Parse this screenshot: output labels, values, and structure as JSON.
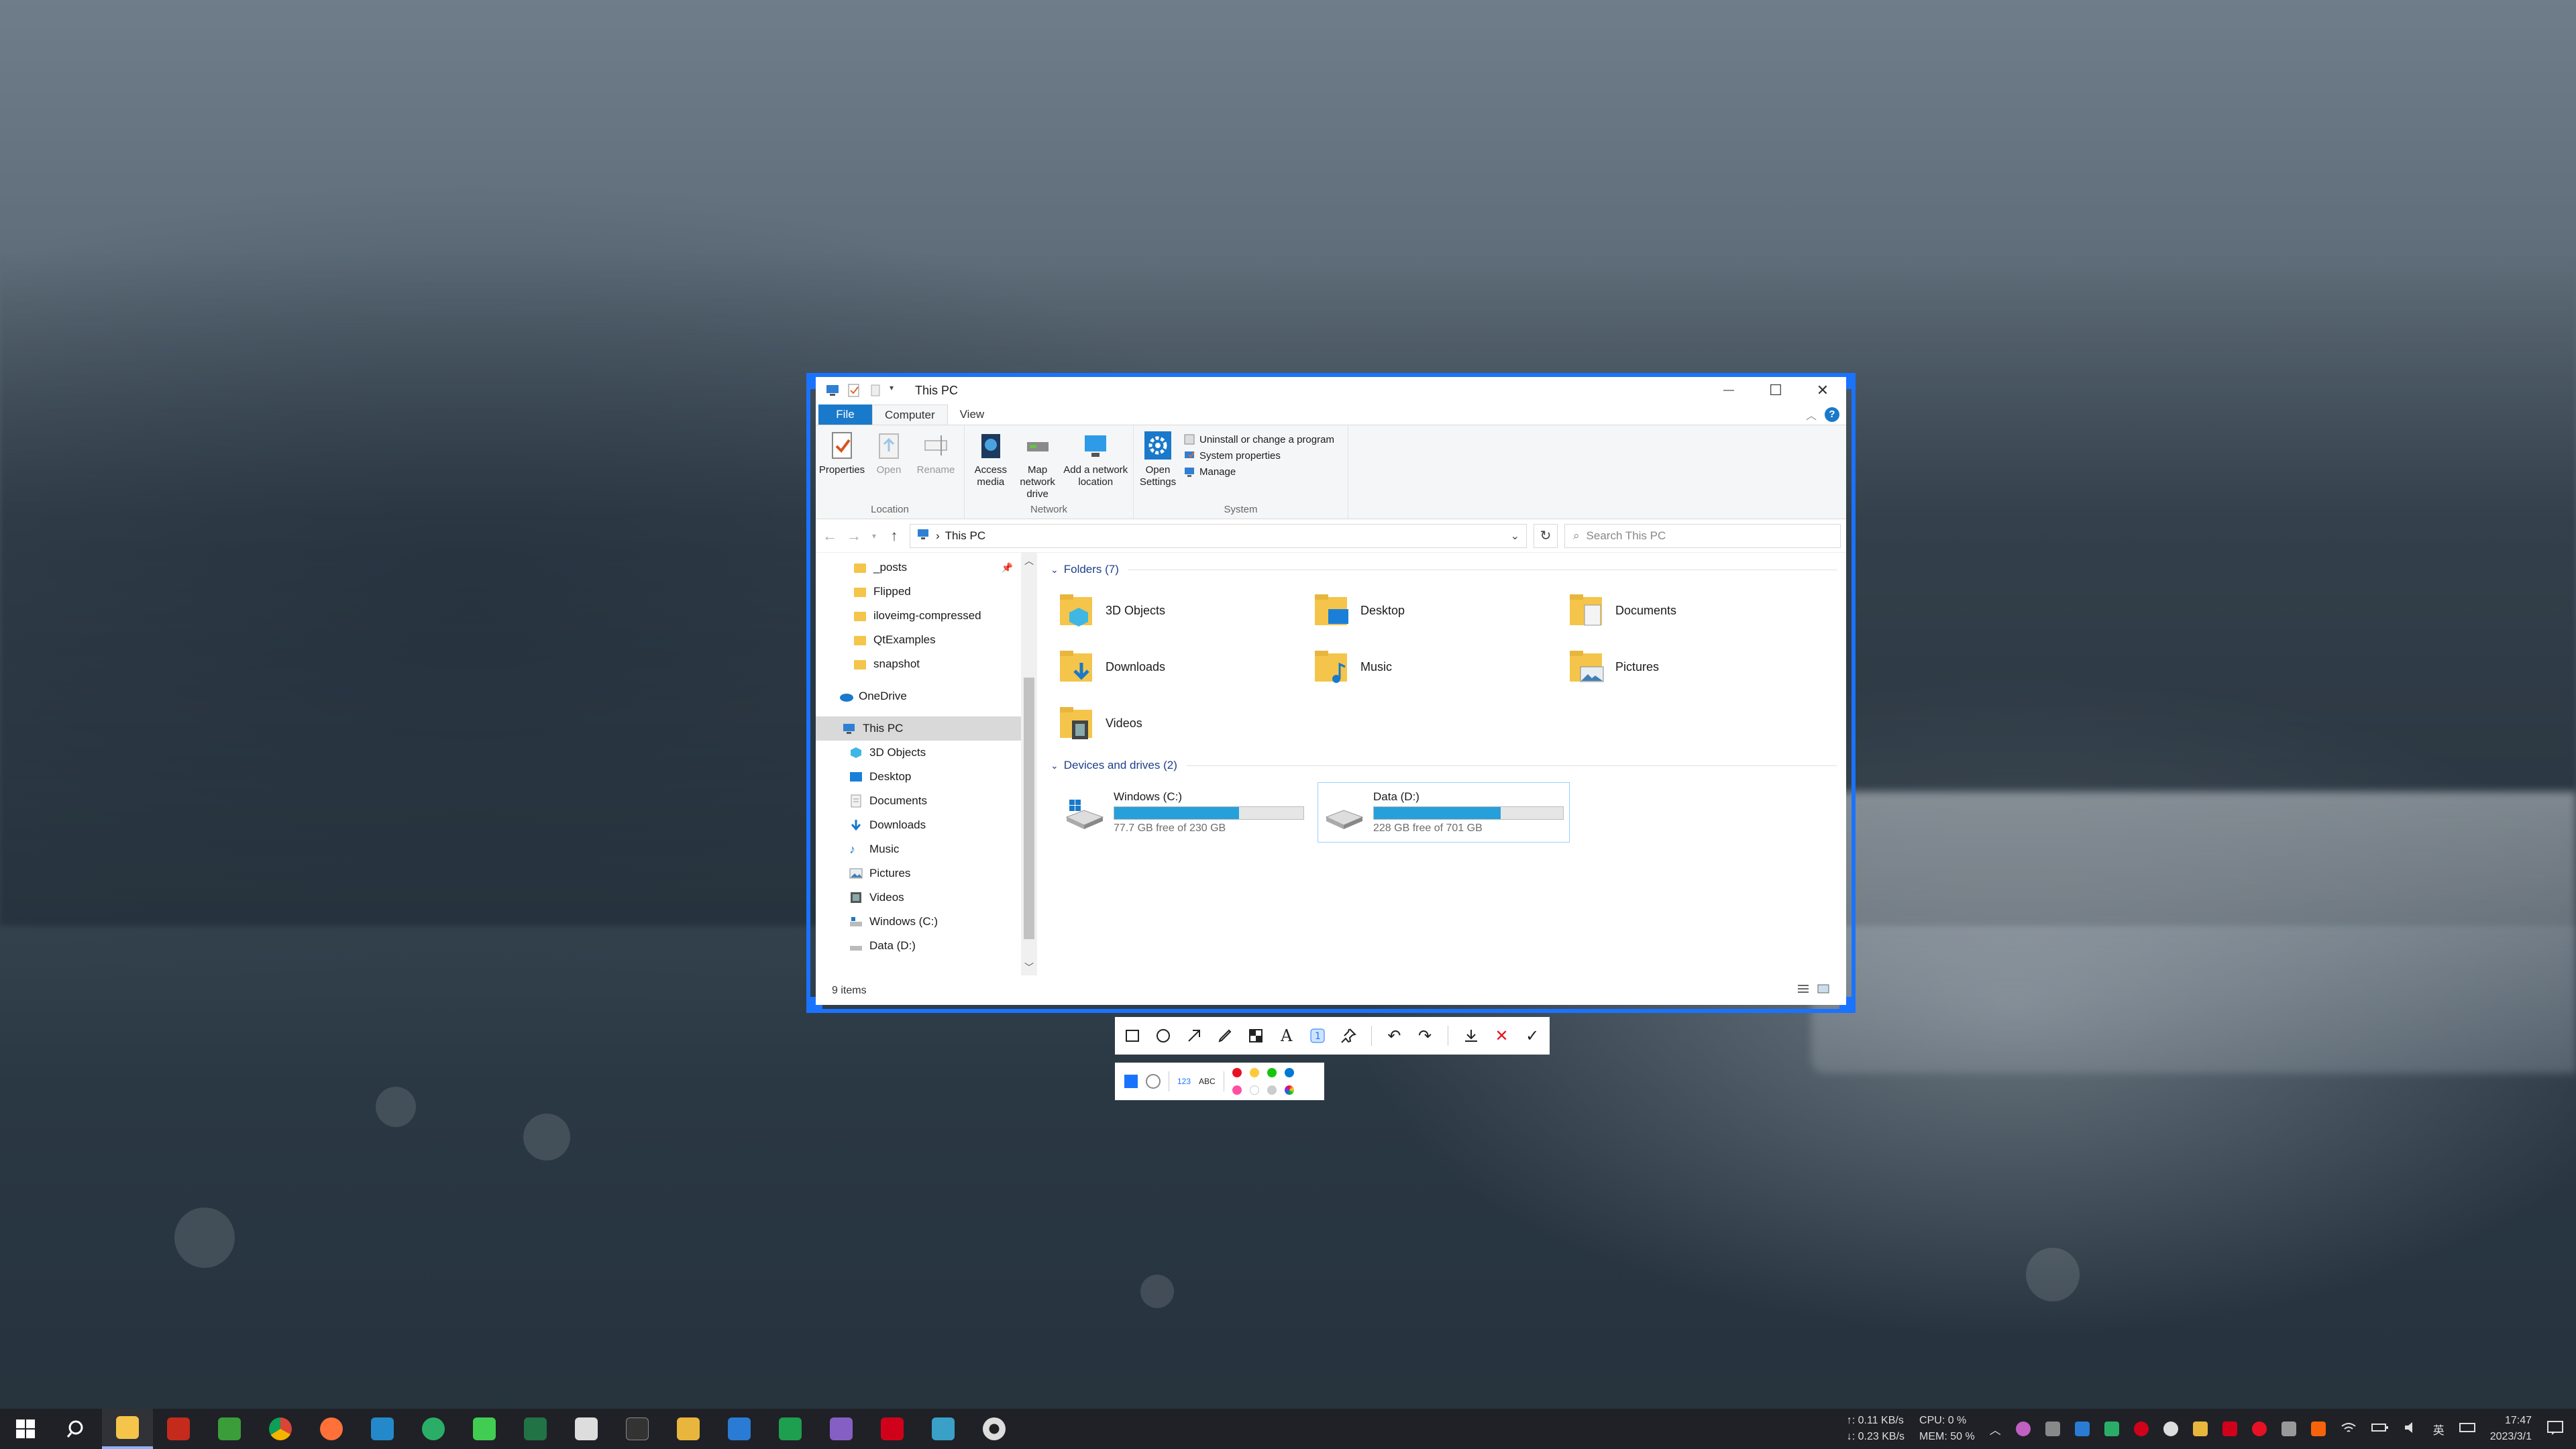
{
  "window": {
    "title": "This PC",
    "controls": {
      "minimize": "—",
      "maximize": "☐",
      "close": "✕"
    }
  },
  "ribbon": {
    "tabs": [
      "File",
      "Computer",
      "View"
    ],
    "active_tab": "Computer",
    "help": "?",
    "groups": {
      "location": {
        "label": "Location",
        "buttons": [
          "Properties",
          "Open",
          "Rename"
        ]
      },
      "network": {
        "label": "Network",
        "buttons": [
          "Access media",
          "Map network drive",
          "Add a network location"
        ]
      },
      "system": {
        "label": "System",
        "open_settings": "Open Settings",
        "items": [
          "Uninstall or change a program",
          "System properties",
          "Manage"
        ]
      }
    }
  },
  "nav": {
    "address": "This PC",
    "search_placeholder": "Search This PC"
  },
  "sidebar": {
    "quick_access": [
      "_posts",
      "Flipped",
      "iloveimg-compressed",
      "QtExamples",
      "snapshot"
    ],
    "onedrive": "OneDrive",
    "this_pc": "This PC",
    "this_pc_children": [
      "3D Objects",
      "Desktop",
      "Documents",
      "Downloads",
      "Music",
      "Pictures",
      "Videos",
      "Windows (C:)",
      "Data (D:)"
    ]
  },
  "content": {
    "folders_header": "Folders (7)",
    "folders": [
      "3D Objects",
      "Desktop",
      "Documents",
      "Downloads",
      "Music",
      "Pictures",
      "Videos"
    ],
    "drives_header": "Devices and drives (2)",
    "drives": [
      {
        "name": "Windows (C:)",
        "free": "77.7 GB free of 230 GB",
        "used_fraction": 0.66
      },
      {
        "name": "Data (D:)",
        "free": "228 GB free of 701 GB",
        "used_fraction": 0.67
      }
    ]
  },
  "status": {
    "items": "9 items"
  },
  "snip_toolbar": {
    "tools": [
      "rectangle-icon",
      "ellipse-icon",
      "arrow-icon",
      "pen-icon",
      "mosaic-icon",
      "text-icon",
      "serial-number-icon",
      "pin-icon",
      "undo-icon",
      "redo-icon",
      "save-icon",
      "cancel-icon",
      "confirm-icon"
    ],
    "text_label": "A",
    "abc_label": "ABC",
    "num_label": "123",
    "colors": [
      "#e81123",
      "#ffc83d",
      "#16c60c",
      "#0078d4",
      "#f7630c",
      "#ff4fa1",
      "#ffffff",
      "#a020f0"
    ]
  },
  "taskbar": {
    "net_up": "↑: 0.11 KB/s",
    "net_down": "↓: 0.23 KB/s",
    "cpu": "CPU: 0 %",
    "mem": "MEM: 50 %",
    "ime": "英",
    "time": "17:47",
    "date": "2023/3/1"
  }
}
